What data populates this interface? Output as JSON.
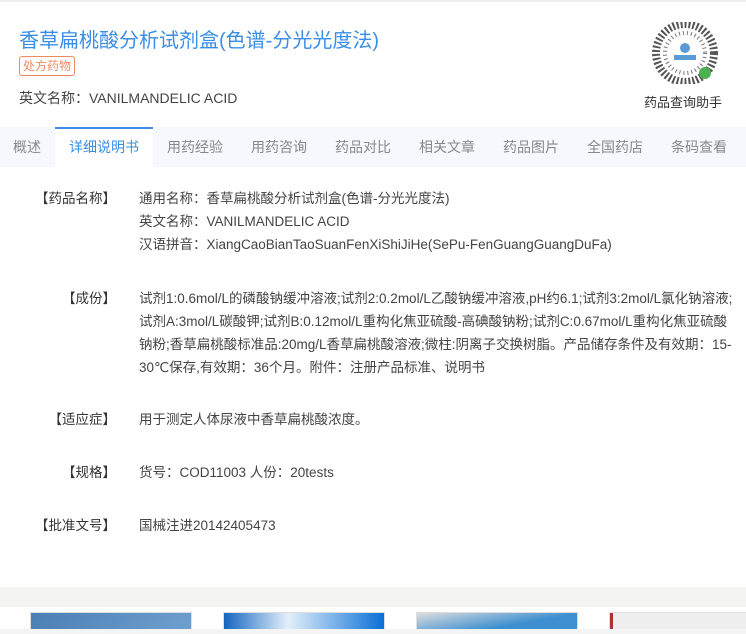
{
  "header": {
    "title": "香草扁桃酸分析试剂盒(色谱-分光光度法)",
    "tag": "处方药物",
    "english_name": "英文名称：VANILMANDELIC ACID",
    "qr_label": "药品查询助手"
  },
  "tabs": [
    "概述",
    "详细说明书",
    "用药经验",
    "用药咨询",
    "药品对比",
    "相关文章",
    "药品图片",
    "全国药店",
    "条码查看"
  ],
  "details": [
    {
      "label": "【药品名称】",
      "lines": [
        "通用名称：香草扁桃酸分析试剂盒(色谱-分光光度法)",
        "英文名称：VANILMANDELIC ACID",
        "汉语拼音：XiangCaoBianTaoSuanFenXiShiJiHe(SePu-FenGuangGuangDuFa)"
      ]
    },
    {
      "label": "【成份】",
      "text": "试剂1:0.6mol/L的磷酸钠缓冲溶液;试剂2:0.2mol/L乙酸钠缓冲溶液,pH约6.1;试剂3:2mol/L氯化钠溶液;试剂A:3mol/L碳酸钾;试剂B:0.12mol/L重构化焦亚硫酸-高碘酸钠粉;试剂C:0.67mol/L重构化焦亚硫酸钠粉;香草扁桃酸标准品:20mg/L香草扁桃酸溶液;微柱:阴离子交换树脂。产品储存条件及有效期：15-30℃保存,有效期：36个月。附件：注册产品标准、说明书"
    },
    {
      "label": "【适应症】",
      "text": "用于测定人体尿液中香草扁桃酸浓度。"
    },
    {
      "label": "【规格】",
      "text": "货号：COD11003 人份：20tests"
    },
    {
      "label": "【批准文号】",
      "text": "国械注进20142405473"
    }
  ]
}
